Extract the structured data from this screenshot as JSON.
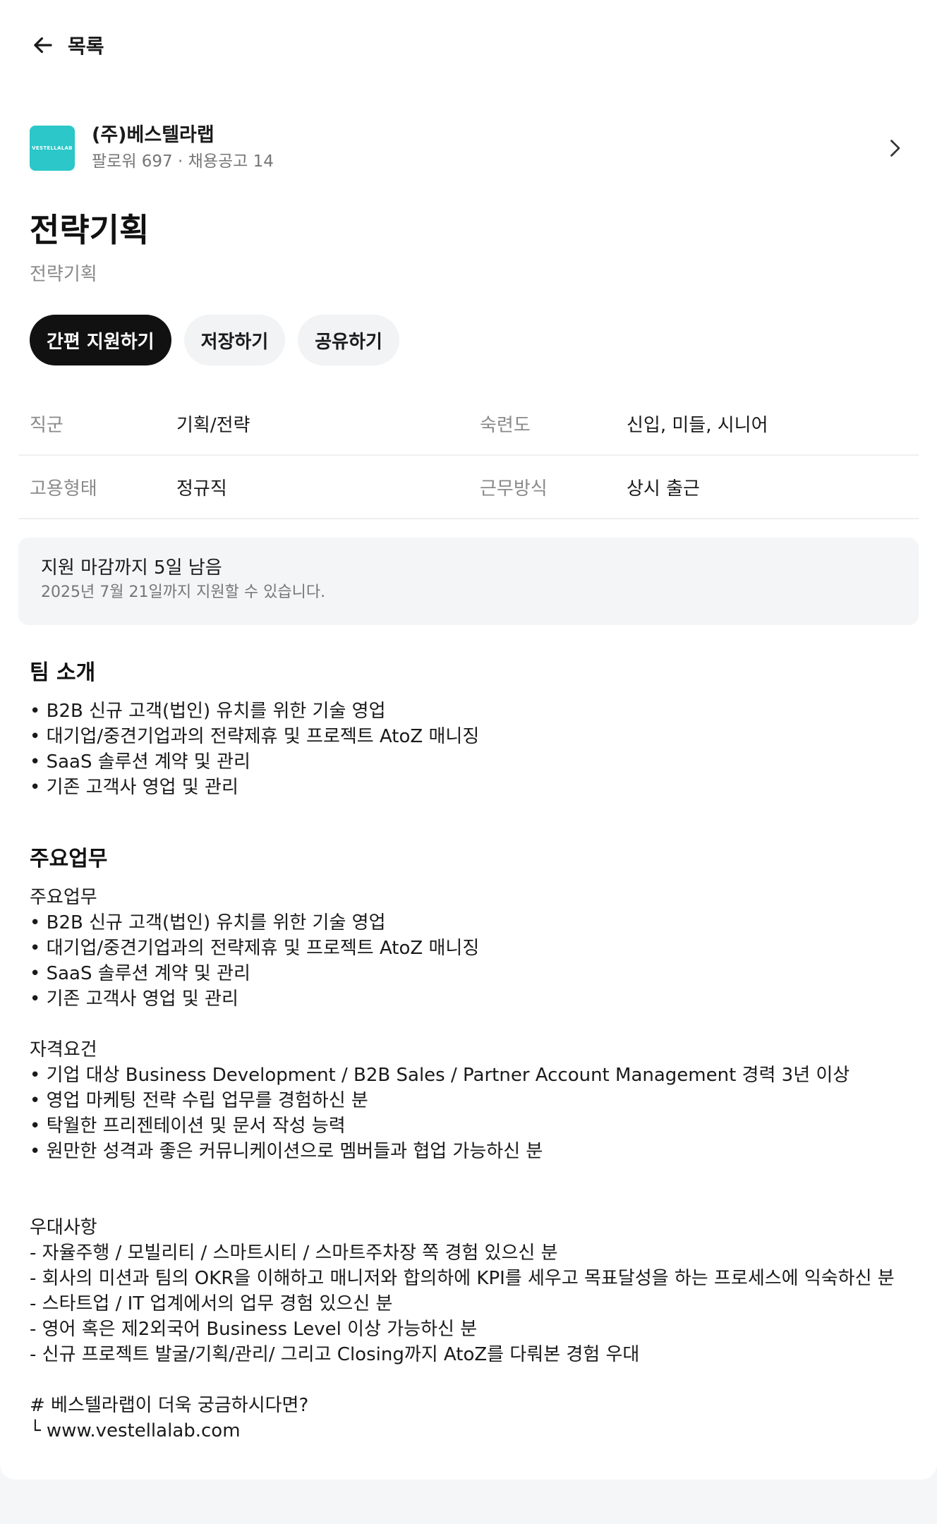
{
  "nav": {
    "back_label": "목록"
  },
  "company": {
    "logo_text": "VESTELLALAB",
    "logo_color": "#2bc7c9",
    "name": "(주)베스텔라랩",
    "meta": "팔로워 697 · 채용공고 14"
  },
  "job": {
    "title": "전략기획",
    "subtitle": "전략기획"
  },
  "actions": {
    "apply": "간편 지원하기",
    "save": "저장하기",
    "share": "공유하기"
  },
  "info": {
    "rows": [
      {
        "label1": "직군",
        "value1": "기획/전략",
        "label2": "숙련도",
        "value2": "신입, 미들, 시니어"
      },
      {
        "label1": "고용형태",
        "value1": "정규직",
        "label2": "근무방식",
        "value2": "상시 출근"
      }
    ]
  },
  "deadline": {
    "title": "지원 마감까지 5일 남음",
    "desc": "2025년 7월 21일까지 지원할 수 있습니다."
  },
  "sections": {
    "team": {
      "title": "팀 소개",
      "body": "• B2B 신규 고객(법인) 유치를 위한 기술 영업\n• 대기업/중견기업과의 전략제휴 및 프로젝트 AtoZ 매니징\n• SaaS 솔루션 계약 및 관리\n• 기존 고객사 영업 및 관리"
    },
    "duties": {
      "title": "주요업무",
      "body": "주요업무\n• B2B 신규 고객(법인) 유치를 위한 기술 영업\n• 대기업/중견기업과의 전략제휴 및 프로젝트 AtoZ 매니징\n• SaaS 솔루션 계약 및 관리\n• 기존 고객사 영업 및 관리\n\n자격요건\n• 기업 대상 Business Development / B2B Sales / Partner Account Management 경력 3년 이상\n• 영업 마케팅 전략 수립 업무를 경험하신 분\n• 탁월한 프리젠테이션 및 문서 작성 능력\n• 원만한 성격과 좋은 커뮤니케이션으로 멤버들과 협업 가능하신 분\n\n\n우대사항\n- 자율주행 / 모빌리티 / 스마트시티 / 스마트주차장 쪽 경험 있으신 분\n- 회사의 미션과 팀의 OKR을 이해하고 매니저와 합의하에 KPI를 세우고 목표달성을 하는 프로세스에 익숙하신 분\n- 스타트업 / IT 업계에서의 업무 경험 있으신 분\n- 영어 혹은 제2외국어 Business Level 이상 가능하신 분\n- 신규 프로젝트 발굴/기획/관리/ 그리고 Closing까지 AtoZ를 다뤄본 경험 우대\n\n# 베스텔라랩이 더욱 궁금하시다면?\n└ www.vestellalab.com"
    }
  },
  "icons": {
    "back": "arrow-left-icon",
    "company_link": "chevron-right-icon"
  }
}
